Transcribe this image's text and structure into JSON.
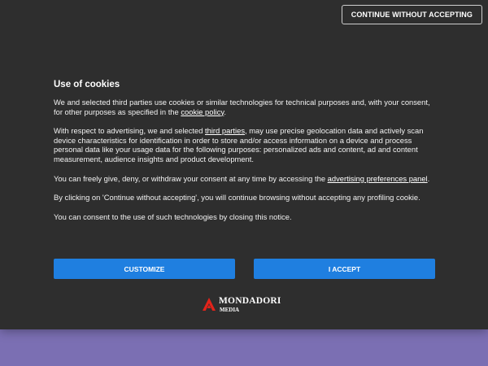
{
  "banner": {
    "continue_without_accepting": "CONTINUE WITHOUT ACCEPTING",
    "title": "Use of cookies",
    "p1_text": "We and selected third parties use cookies or similar technologies for technical purposes and, with your consent, for other purposes as specified in the ",
    "p1_link": "cookie policy",
    "p1_end": ".",
    "p2_start": "With respect to advertising, we and selected ",
    "p2_link": "third parties",
    "p2_text": ", may use precise geolocation data and actively scan device characteristics for identification in order to store and/or access information on a device and process personal data like your usage data for the following purposes: personalized ads and content, ad and content measurement, audience insights and product development.",
    "p3_text": "You can freely give, deny, or withdraw your consent at any time by accessing the ",
    "p3_link": "advertising preferences panel",
    "p3_end": ".",
    "p4_text": "By clicking on 'Continue without accepting', you will continue browsing without accepting any profiling cookie.",
    "p5_text": "You can consent to the use of such technologies by closing this notice.",
    "customize_label": "CUSTOMIZE",
    "accept_label": "I ACCEPT",
    "logo_name": "MONDADORI",
    "logo_sub": "MEDIA"
  },
  "colors": {
    "banner_bg": "#2e2e2e",
    "page_bg": "#7b6fb3",
    "button_blue": "#1f7fe0",
    "logo_red": "#e2231a"
  }
}
